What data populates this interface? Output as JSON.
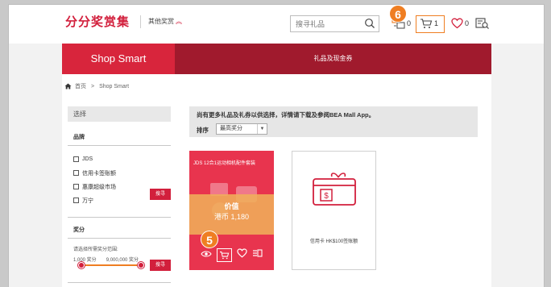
{
  "header": {
    "logo_text": "分分奖赏集",
    "other_rewards": "其他奖赏",
    "search_placeholder": "搜寻礼品",
    "compare_count": "0",
    "cart_count": "1",
    "wishlist_count": "0"
  },
  "nav": {
    "active_tab": "Shop Smart",
    "second_tab": "礼品及现金券"
  },
  "breadcrumb": {
    "home": "首页",
    "separator": ">",
    "current": "Shop Smart"
  },
  "sidebar": {
    "header": "选择",
    "brand_title": "品牌",
    "brands": [
      "JDS",
      "信用卡签账额",
      "惠康超级市场",
      "万宁"
    ],
    "search_button": "搜寻",
    "points_title": "奖分",
    "points_hint": "请选择所需奖分范围:",
    "points_min": "1,000 奖分",
    "points_max": "9,000,000 奖分",
    "points_button": "搜寻"
  },
  "main": {
    "notice": "尚有更多礼品及礼券以供选择，详情请下载及参阅BEA Mall App。",
    "sort_label": "排序",
    "sort_value": "最高奖分"
  },
  "products": [
    {
      "title": "JDS 12合1运动相机配件套装",
      "price_label": "价值",
      "price_value": "港币 1,180"
    },
    {
      "title": "信用卡 HK$100签账额"
    }
  ],
  "callouts": {
    "header_cart": "6",
    "product_cart": "5"
  },
  "colors": {
    "brand_red": "#d21f3c",
    "nav_dark": "#a01a2d",
    "callout_orange": "#ef7e22"
  }
}
